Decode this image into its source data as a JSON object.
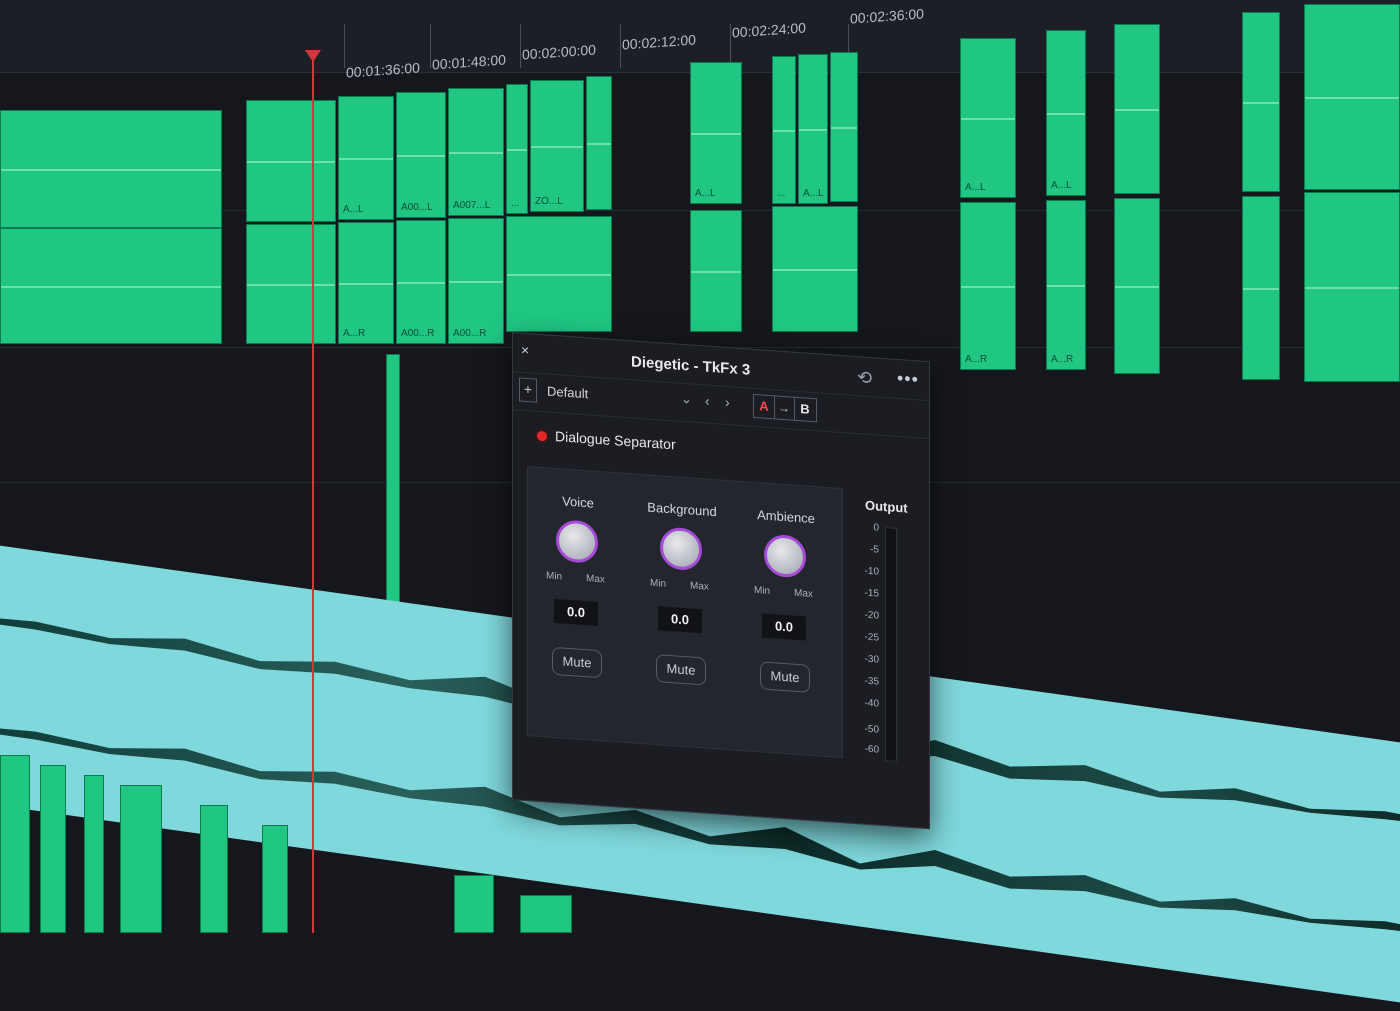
{
  "timeline": {
    "timecodes": [
      "00:01:36:00",
      "00:01:48:00",
      "00:02:00:00",
      "00:02:12:00",
      "00:02:24:00",
      "00:02:36:00"
    ],
    "clip_labels": [
      "A...L",
      "A00...L",
      "A007...L",
      "...",
      "ZO...L",
      "A...L",
      "...",
      "A...L",
      "A...R",
      "A00...R",
      "A00...R",
      "A...L",
      "A...L",
      "A...R",
      "A...R"
    ]
  },
  "plugin": {
    "close_glyph": "×",
    "title": "Diegetic - TkFx 3",
    "reset_glyph": "⟲",
    "more_glyph": "•••",
    "add_glyph": "+",
    "preset": "Default",
    "dropdown_glyph": "⌄",
    "prev_glyph": "‹",
    "next_glyph": "›",
    "ab": {
      "a": "A",
      "arrow": "→",
      "b": "B"
    },
    "effect_name": "Dialogue Separator",
    "knobs": [
      {
        "label": "Voice",
        "min": "Min",
        "max": "Max",
        "value": "0.0",
        "mute": "Mute"
      },
      {
        "label": "Background",
        "min": "Min",
        "max": "Max",
        "value": "0.0",
        "mute": "Mute"
      },
      {
        "label": "Ambience",
        "min": "Min",
        "max": "Max",
        "value": "0.0",
        "mute": "Mute"
      }
    ],
    "output": {
      "title": "Output",
      "scale": [
        "0",
        "-5",
        "-10",
        "-15",
        "-20",
        "-25",
        "-30",
        "-35",
        "-40",
        "-50",
        "-60"
      ]
    }
  },
  "colors": {
    "clip": "#1fc783",
    "audio_track": "#7fd8dc",
    "playhead": "#d9343c",
    "knob_ring": "#a64bd8",
    "power_led": "#e02a2a"
  }
}
